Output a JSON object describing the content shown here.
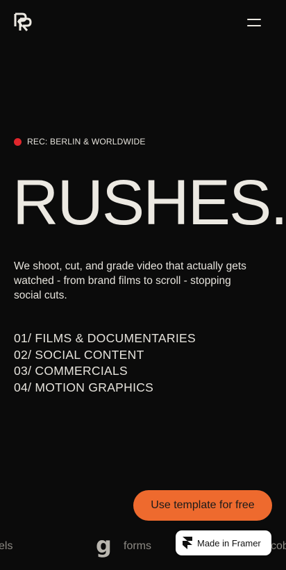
{
  "header": {
    "logo_icon": "rushes-monogram-icon",
    "menu_icon": "hamburger-menu-icon"
  },
  "hero": {
    "rec_label": "REC: BERLIN & WORLDWIDE",
    "rec_color": "#e0262c",
    "title": "RUSHES.",
    "description": "We shoot, cut, and grade video that actually gets watched - from brand films to scroll - stopping social cuts.",
    "services": [
      "01/ FILMS & DOCUMENTARIES",
      "02/ SOCIAL CONTENT",
      "03/ COMMERCIALS",
      "04/ MOTION GRAPHICS"
    ]
  },
  "cta": {
    "label": "Use template for free",
    "color": "#ee6a2e"
  },
  "ticker": {
    "left_fragment": "els",
    "g_glyph": "g",
    "forms_label": "forms",
    "right_fragment": "cob"
  },
  "framer_badge": {
    "label": "Made in Framer",
    "icon": "framer-logo-icon"
  }
}
